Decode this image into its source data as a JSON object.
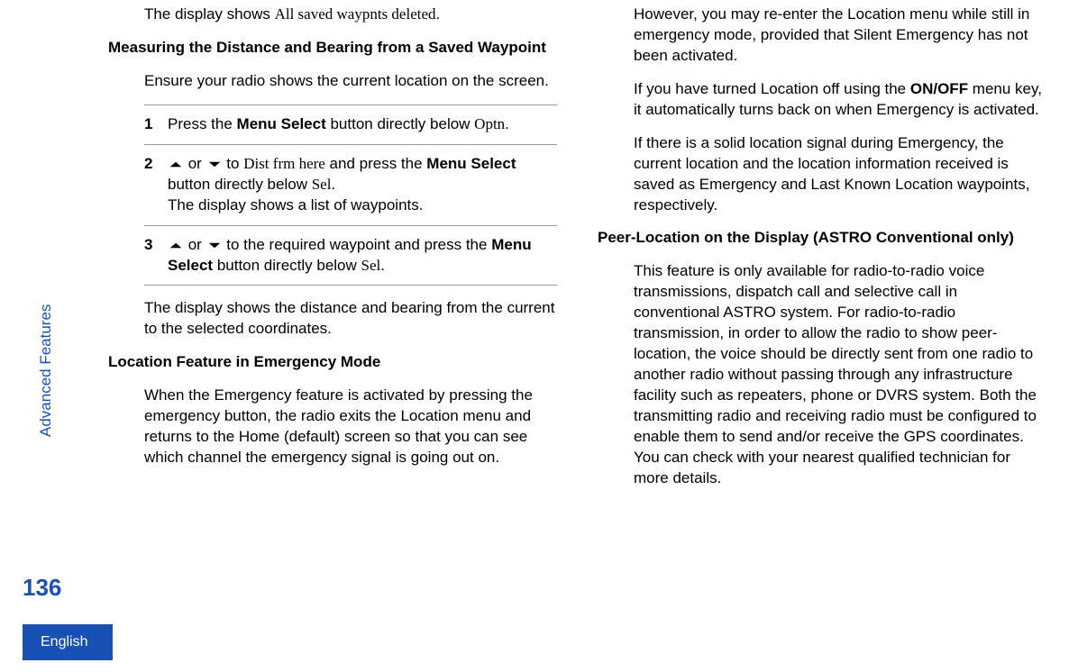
{
  "sidebar": {
    "section": "Advanced Features",
    "pageNumber": "136",
    "language": "English"
  },
  "left": {
    "intro": {
      "prefix": "The display shows ",
      "serif": "All saved waypnts deleted",
      "suffix": "."
    },
    "heading1": "Measuring the Distance and Bearing from a Saved Waypoint",
    "ensure": "Ensure your radio shows the current location on the screen.",
    "steps": [
      {
        "num": "1",
        "parts": [
          {
            "t": "Press the "
          },
          {
            "t": "Menu Select",
            "b": true
          },
          {
            "t": " button directly below "
          },
          {
            "t": "Optn",
            "s": true
          },
          {
            "t": "."
          }
        ]
      },
      {
        "num": "2",
        "parts": [
          {
            "icon": "up"
          },
          {
            "t": " or "
          },
          {
            "icon": "down"
          },
          {
            "t": " to "
          },
          {
            "t": "Dist frm here",
            "s": true
          },
          {
            "t": " and press the "
          },
          {
            "t": "Menu Select",
            "b": true
          },
          {
            "t": " button directly below "
          },
          {
            "t": "Sel",
            "s": true
          },
          {
            "t": "."
          },
          {
            "br": true
          },
          {
            "t": "The display shows a list of waypoints."
          }
        ]
      },
      {
        "num": "3",
        "parts": [
          {
            "icon": "up"
          },
          {
            "t": " or "
          },
          {
            "icon": "down"
          },
          {
            "t": " to the required waypoint and press the "
          },
          {
            "t": "Menu Select",
            "b": true
          },
          {
            "t": " button directly below "
          },
          {
            "t": "Sel",
            "s": true
          },
          {
            "t": "."
          }
        ]
      }
    ],
    "afterSteps": "The display shows the distance and bearing from the current to the selected coordinates.",
    "heading2": "Location Feature in Emergency Mode",
    "emergency1": "When the Emergency feature is activated by pressing the emergency button, the radio exits the Location menu and returns to the Home (default) screen so that you can see which channel the emergency signal is going out on."
  },
  "right": {
    "p1": "However, you may re-enter the Location menu while still in emergency mode, provided that Silent Emergency has not been activated.",
    "p2": {
      "pre": "If you have turned Location off using the ",
      "b": "ON/OFF",
      "post": " menu key, it automatically turns back on when Emergency is activated."
    },
    "p3": "If there is a solid location signal during Emergency, the current location and the location information received is saved as Emergency and Last Known Location waypoints, respectively.",
    "heading": "Peer-Location on the Display (ASTRO Conventional only)",
    "p4": "This feature is only available for radio-to-radio voice transmissions, dispatch call and selective call in conventional ASTRO system. For radio-to-radio transmission, in order to allow the radio to show peer-location, the voice should be directly sent from one radio to another radio without passing through any infrastructure facility such as repeaters, phone or DVRS system. Both the transmitting radio and receiving radio must be configured to enable them to send and/or receive the GPS coordinates. You can check with your nearest qualified technician for more details."
  }
}
